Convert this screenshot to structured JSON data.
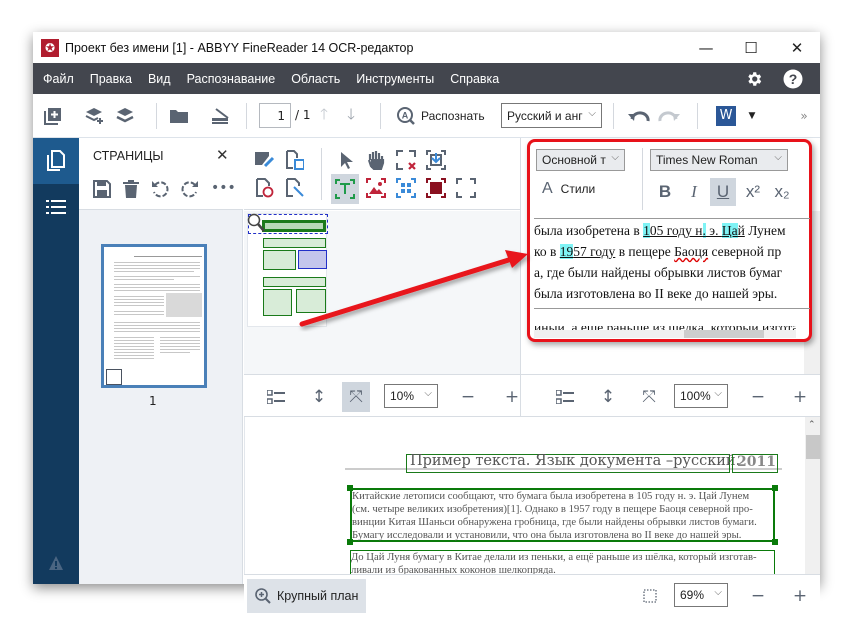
{
  "window": {
    "title": "Проект без имени [1] - ABBYY FineReader 14 OCR-редактор",
    "logo_icon": "abbyy-logo-icon",
    "controls": {
      "minimize": "—",
      "maximize": "☐",
      "close": "✕"
    }
  },
  "menu": {
    "items": [
      "Файл",
      "Правка",
      "Вид",
      "Распознавание",
      "Область",
      "Инструменты",
      "Справка"
    ],
    "settings_icon": "gear-icon",
    "help_icon": "help-icon"
  },
  "toolbar": {
    "page_current": "1",
    "page_total": "/ 1",
    "recognize_label": "Распознать",
    "language": "Русский и анг",
    "more": "»",
    "word_label": "W"
  },
  "pages_panel": {
    "title": "СТРАНИЦЫ",
    "close": "✕",
    "thumbnail_page_number": "1"
  },
  "text_editor": {
    "style_select": "Основной т",
    "font_select": "Times New Roman",
    "styles_label": "Стили",
    "bold": "B",
    "italic": "I",
    "underline": "U",
    "superscript": "x²",
    "subscript": "x₂",
    "more": "»",
    "lines": [
      "была изобретена в 105 году н. э. Цай Лунем",
      "ко в 1957 году в пещере Баоця северной пр",
      "а, где были найдены обрывки листов бумаг",
      "была изготовлена во II веке до нашей эры.",
      "иныи. а ещё раньше из шёлка, который изготав"
    ]
  },
  "image_zoom": {
    "value": "10%",
    "minus": "−",
    "plus": "+"
  },
  "text_zoom": {
    "value": "100%",
    "minus": "−",
    "plus": "+"
  },
  "document": {
    "heading": "Пример текста. Язык документа –русский.",
    "year": "2011",
    "paragraph1": [
      "Китайские летописи сообщают, что бумага была изобретена в 105 году н. э. Цай Лунем",
      "(см. четыре великих изобретения)[1]. Однако в 1957 году в пещере Баоця северной про-",
      "винции Китая Шаньси обнаружена гробница, где были найдены обрывки листов бумаги.",
      "Бумагу исследовали и установили, что она была изготовлена во II веке до нашей эры."
    ],
    "paragraph2": [
      "До Цай Луня бумагу в Китае делали из пеньки, а ещё раньше из шёлка, который изготав-",
      "ливали из бракованных коконов шелкопряда."
    ]
  },
  "bottom": {
    "closeup_label": "Крупный план",
    "zoom_value": "69%",
    "minus": "−",
    "plus": "+"
  },
  "colors": {
    "menubar": "#43464e",
    "nav": "#123a5e",
    "nav_active": "#1e5a8e",
    "highlight_box": "#e8121a",
    "text_area": "#1a7a1a",
    "picture_area": "#2230c8"
  }
}
